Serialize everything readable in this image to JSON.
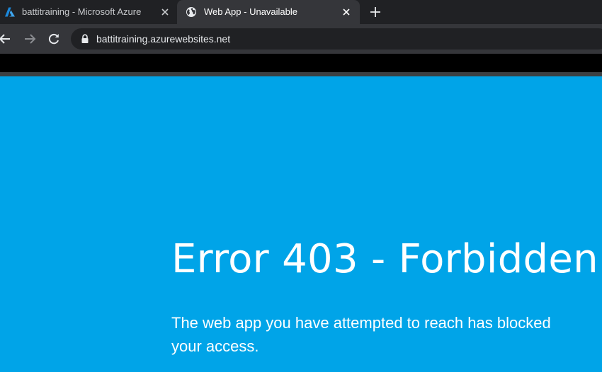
{
  "browser": {
    "tabs": [
      {
        "title": "battitraining - Microsoft Azure",
        "favicon": "azure-logo-icon",
        "active": false
      },
      {
        "title": "Web App - Unavailable",
        "favicon": "globe-icon",
        "active": true
      }
    ],
    "new_tab_icon": "plus-icon",
    "close_icon": "close-icon",
    "nav": {
      "back_icon": "back-arrow-icon",
      "forward_icon": "forward-arrow-icon",
      "reload_icon": "reload-icon"
    },
    "address_bar": {
      "url": "battitraining.azurewebsites.net",
      "icon": "lock-icon"
    }
  },
  "page": {
    "title": "Error 403 - Forbidden",
    "message": "The web app you have attempted to reach has blocked your access.",
    "background_color": "#00a4e8",
    "text_color": "#ffffff"
  }
}
